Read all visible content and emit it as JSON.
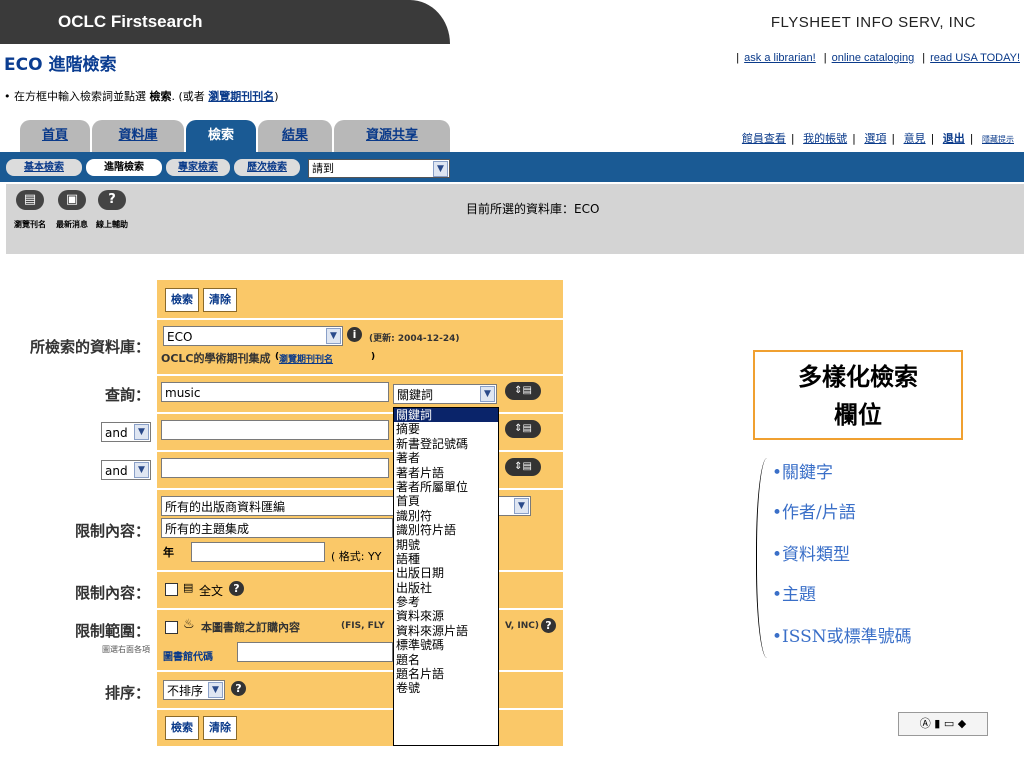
{
  "header": {
    "logo": "OCLC Firstsearch",
    "vendor": "FLYSHEET INFO SERV, INC"
  },
  "page_title": "ECO 進階檢索",
  "top_links": [
    "ask a librarian!",
    "online cataloging",
    "read USA TODAY!"
  ],
  "instruction": {
    "prefix": "在方框中輸入檢索詞並點選",
    "bold": "檢索",
    "middle": ". (或者",
    "link": "瀏覽期刊刊名",
    "suffix": ")"
  },
  "main_tabs": [
    "首頁",
    "資料庫",
    "檢索",
    "結果",
    "資源共享"
  ],
  "right_links": [
    "館員查看",
    "我的帳號",
    "選項",
    "意見",
    "退出",
    "隱藏提示"
  ],
  "sub_tabs": [
    "基本檢索",
    "進階檢索",
    "專家檢索",
    "歷次檢索"
  ],
  "goto_select": "請到",
  "toolbar": [
    {
      "icon": "browse-titles-icon",
      "glyph": "▤",
      "label": "瀏覽刊名"
    },
    {
      "icon": "news-icon",
      "glyph": "▣",
      "label": "最新消息"
    },
    {
      "icon": "help-icon",
      "glyph": "?",
      "label": "線上輔助"
    }
  ],
  "current_db": "目前所選的資料庫：ECO",
  "form": {
    "search_btn": "檢索",
    "clear_btn": "清除",
    "db_label": "所檢索的資料庫：",
    "db_value": "ECO",
    "db_updated": "(更新: 2004-12-24)",
    "db_desc": "OCLC的學術期刊集成",
    "db_desc_link": "瀏覽期刊刊名",
    "query_label": "查詢：",
    "query_value": "music",
    "field_value": "關鍵詞",
    "bool1": "and",
    "bool2": "and",
    "limit_label": "限制內容：",
    "limit_pub": "所有的出版商資料匯編",
    "limit_subject": "所有的主題集成",
    "year_label": "年",
    "year_format": "( 格式: YY",
    "fulltext_label": "限制內容：",
    "fulltext": "全文",
    "scope_label": "限制範圍：",
    "scope_sub": "圖選右面各項",
    "scope_text": "本圖書館之訂購內容",
    "scope_tail": "(FIS, FLY",
    "scope_tail2": "V, INC)",
    "library_label": "圖書館代碼",
    "sort_label": "排序：",
    "sort_value": "不排序"
  },
  "dropdown_options": [
    "關鍵詞",
    "摘要",
    "新書登記號碼",
    "著者",
    "著者片語",
    "著者所屬單位",
    "首頁",
    "識別符",
    "識別符片語",
    "期號",
    "語種",
    "出版日期",
    "出版社",
    "參考",
    "資料來源",
    "資料來源片語",
    "標準號碼",
    "題名",
    "題名片語",
    "卷號"
  ],
  "annotation": {
    "title_line1": "多樣化檢索",
    "title_line2": "欄位",
    "bullets": [
      "•關鍵字",
      "•作者/片語",
      "•資料類型",
      "•主題",
      "•ISSN或標準號碼"
    ]
  },
  "colors": {
    "tab_active": "#1a5a94",
    "form_bg": "#fac868",
    "accent_border": "#f0a030",
    "bullet_text": "#3a6fc8"
  }
}
